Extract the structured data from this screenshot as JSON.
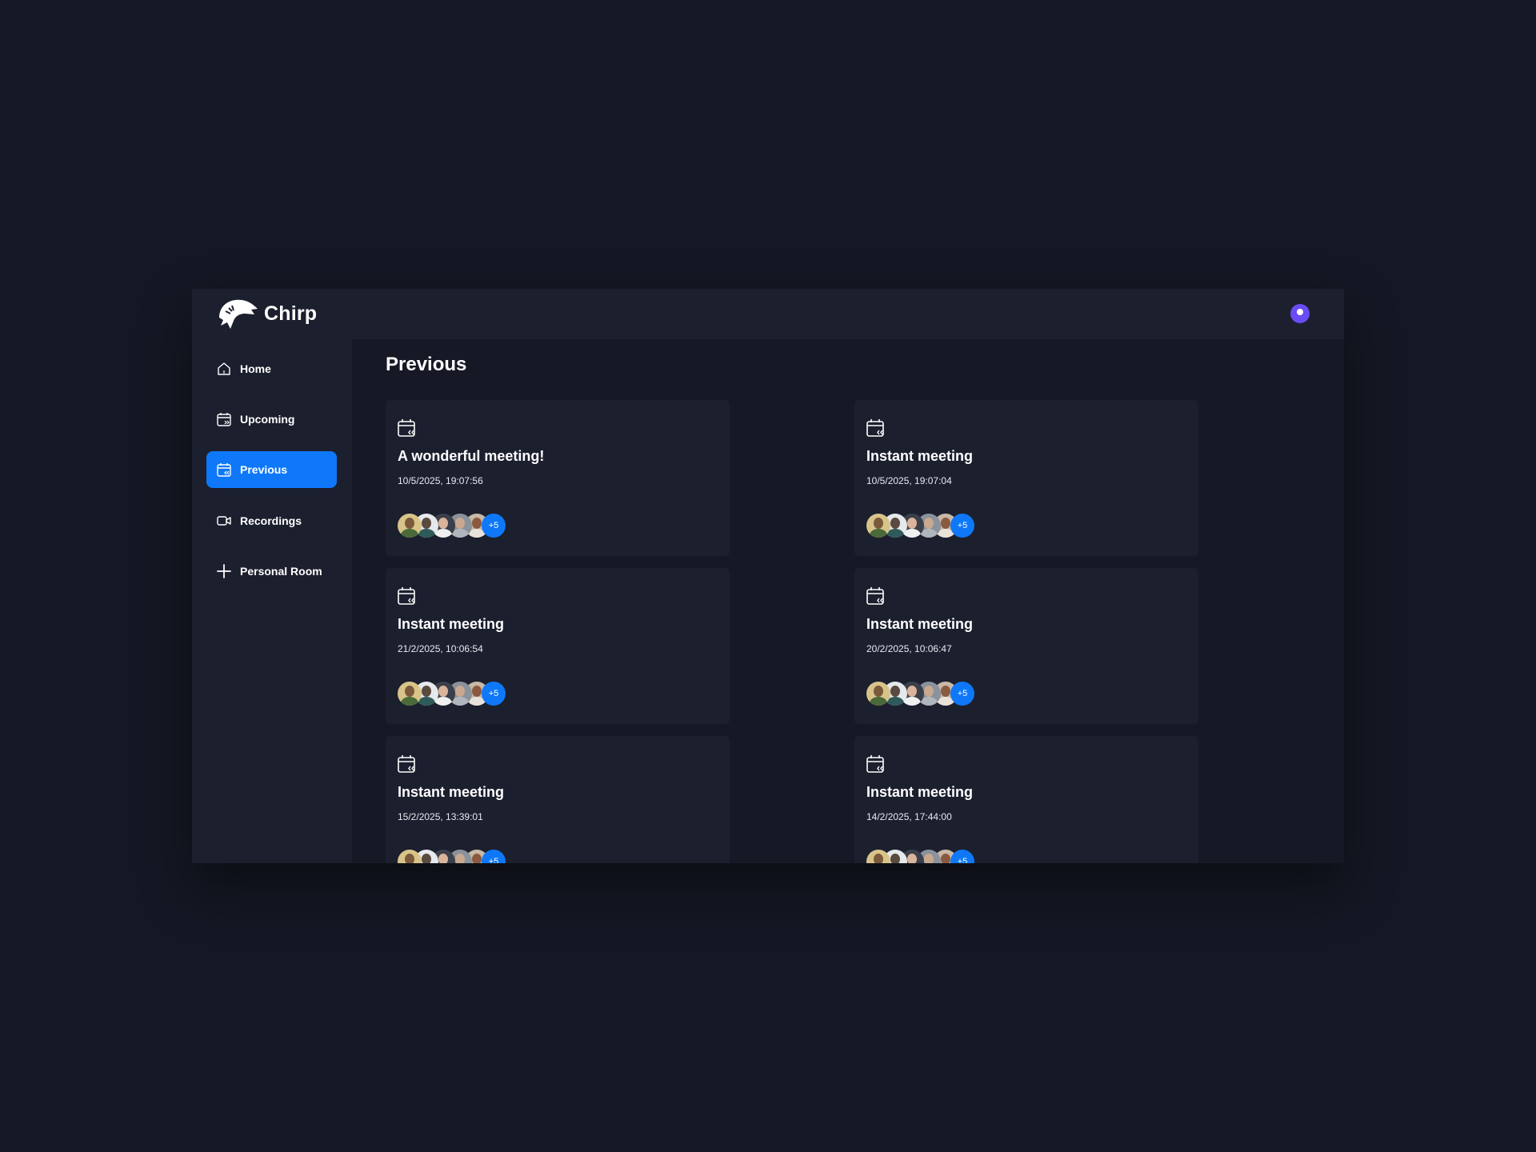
{
  "app": {
    "name": "Chirp"
  },
  "sidebar": {
    "items": [
      {
        "label": "Home",
        "icon": "home-icon",
        "active": false
      },
      {
        "label": "Upcoming",
        "icon": "calendar-upcoming-icon",
        "active": false
      },
      {
        "label": "Previous",
        "icon": "calendar-previous-icon",
        "active": true
      },
      {
        "label": "Recordings",
        "icon": "video-icon",
        "active": false
      },
      {
        "label": "Personal Room",
        "icon": "plus-icon",
        "active": false
      }
    ]
  },
  "main": {
    "title": "Previous",
    "meetings": [
      {
        "title": "A wonderful meeting!",
        "date": "10/5/2025, 19:07:56",
        "more": "+5"
      },
      {
        "title": "Instant meeting",
        "date": "10/5/2025, 19:07:04",
        "more": "+5"
      },
      {
        "title": "Instant meeting",
        "date": "21/2/2025, 10:06:54",
        "more": "+5"
      },
      {
        "title": "Instant meeting",
        "date": "20/2/2025, 10:06:47",
        "more": "+5"
      },
      {
        "title": "Instant meeting",
        "date": "15/2/2025, 13:39:01",
        "more": "+5"
      },
      {
        "title": "Instant meeting",
        "date": "14/2/2025, 17:44:00",
        "more": "+5"
      }
    ]
  },
  "colors": {
    "background": "#151824",
    "panel": "#1c1f2e",
    "accent": "#0e78f9",
    "avatar": "#6a4cf5"
  }
}
